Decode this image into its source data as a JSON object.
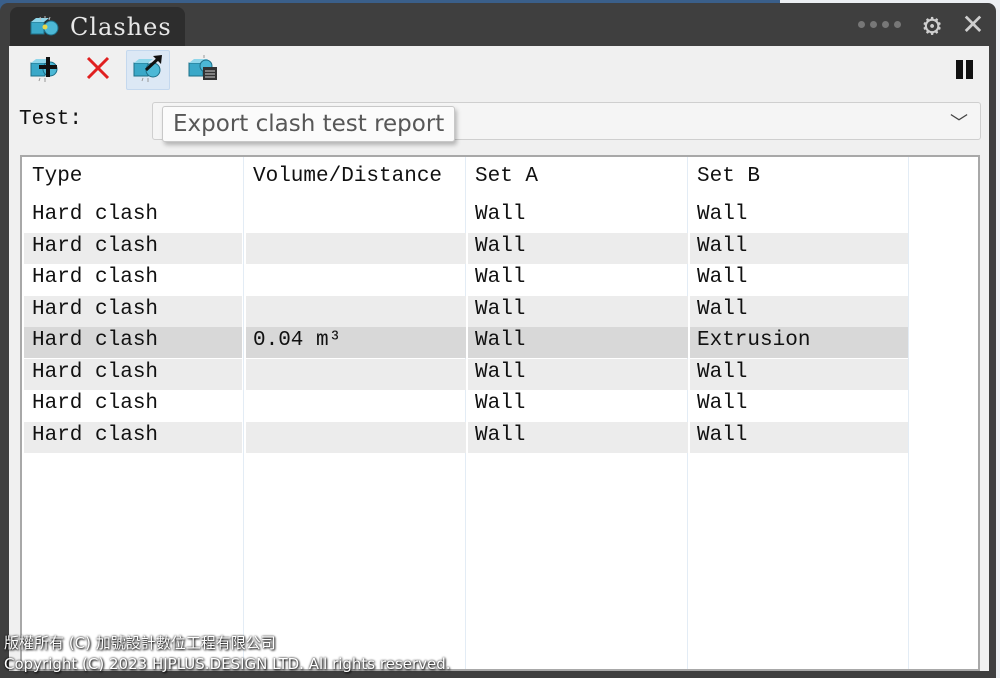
{
  "window": {
    "title": "Clashes",
    "icons": {
      "tab": "clash-spheres-icon",
      "grip": "drag-grip-icon",
      "settings": "gear-icon",
      "close": "close-icon"
    }
  },
  "toolbar": {
    "buttons": [
      {
        "name": "add-clash-test-button",
        "icon": "add-clash-icon"
      },
      {
        "name": "delete-clash-test-button",
        "icon": "delete-x-icon"
      },
      {
        "name": "export-clash-report-button",
        "icon": "export-clash-icon",
        "active": true
      },
      {
        "name": "clash-report-list-button",
        "icon": "clash-report-icon"
      }
    ],
    "pause_icon": "pause-icon"
  },
  "test": {
    "label": "Test:",
    "selected_value": "",
    "chevron_icon": "chevron-down-icon"
  },
  "tooltip": {
    "text": "Export clash test report"
  },
  "table": {
    "columns": [
      "Type",
      "Volume/Distance",
      "Set A",
      "Set B"
    ],
    "rows": [
      {
        "type": "Hard clash",
        "volume": "",
        "set_a": "Wall",
        "set_b": "Wall"
      },
      {
        "type": "Hard clash",
        "volume": "",
        "set_a": "Wall",
        "set_b": "Wall"
      },
      {
        "type": "Hard clash",
        "volume": "",
        "set_a": "Wall",
        "set_b": "Wall"
      },
      {
        "type": "Hard clash",
        "volume": "",
        "set_a": "Wall",
        "set_b": "Wall"
      },
      {
        "type": "Hard clash",
        "volume": "0.04 m³",
        "set_a": "Wall",
        "set_b": "Extrusion",
        "selected": true
      },
      {
        "type": "Hard clash",
        "volume": "",
        "set_a": "Wall",
        "set_b": "Wall"
      },
      {
        "type": "Hard clash",
        "volume": "",
        "set_a": "Wall",
        "set_b": "Wall"
      },
      {
        "type": "Hard clash",
        "volume": "",
        "set_a": "Wall",
        "set_b": "Wall"
      }
    ]
  },
  "footer": {
    "line1": "版權所有 (C) 加號設計數位工程有限公司",
    "line2": "Copyright (C) 2023 HJPLUS.DESIGN LTD. All rights reserved."
  },
  "colors": {
    "titlebar": "#3f3f3f",
    "tab": "#2d2d2d",
    "panel": "#f0f0f0",
    "row_alt": "#ececec",
    "row_selected": "#d8d8d8",
    "delete_red": "#e02020",
    "clash_cyan": "#3aa8c8"
  }
}
